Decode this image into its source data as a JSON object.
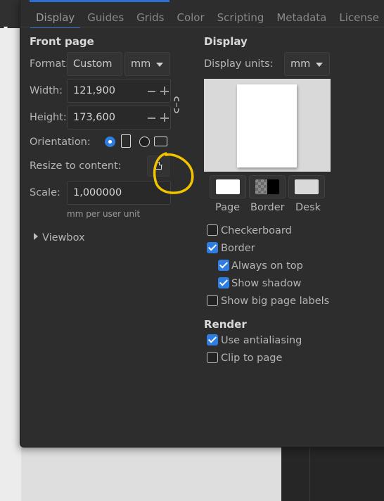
{
  "tabs": [
    {
      "label": "Display",
      "active": true
    },
    {
      "label": "Guides"
    },
    {
      "label": "Grids"
    },
    {
      "label": "Color"
    },
    {
      "label": "Scripting"
    },
    {
      "label": "Metadata"
    },
    {
      "label": "License"
    }
  ],
  "front_page": {
    "title": "Front page",
    "format_label": "Format:",
    "format_value": "Custom",
    "format_unit": "mm",
    "width_label": "Width:",
    "width_value": "121,900",
    "height_label": "Height:",
    "height_value": "173,600",
    "orientation_label": "Orientation:",
    "orientation_selected": "portrait",
    "resize_label": "Resize to content:",
    "scale_label": "Scale:",
    "scale_value": "1,000000",
    "scale_hint": "mm per user unit",
    "viewbox_label": "Viewbox"
  },
  "display": {
    "title": "Display",
    "units_label": "Display units:",
    "units_value": "mm",
    "swatches": [
      {
        "label": "Page",
        "color": "#ffffff"
      },
      {
        "label": "Border",
        "color": "#000000"
      },
      {
        "label": "Desk",
        "color": "#d9d9d9"
      }
    ],
    "checkboxes": {
      "checkerboard": {
        "label": "Checkerboard",
        "checked": false
      },
      "border": {
        "label": "Border",
        "checked": true
      },
      "always_on_top": {
        "label": "Always on top",
        "checked": true
      },
      "show_shadow": {
        "label": "Show shadow",
        "checked": true
      },
      "big_page_labels": {
        "label": "Show big page labels",
        "checked": false
      }
    }
  },
  "render": {
    "title": "Render",
    "antialiasing": {
      "label": "Use antialiasing",
      "checked": true
    },
    "clip_to_page": {
      "label": "Clip to page",
      "checked": false
    }
  },
  "colors": {
    "accent": "#2f7de1",
    "annotation": "#f2c400",
    "dialog_bg": "#2d2d2d"
  }
}
